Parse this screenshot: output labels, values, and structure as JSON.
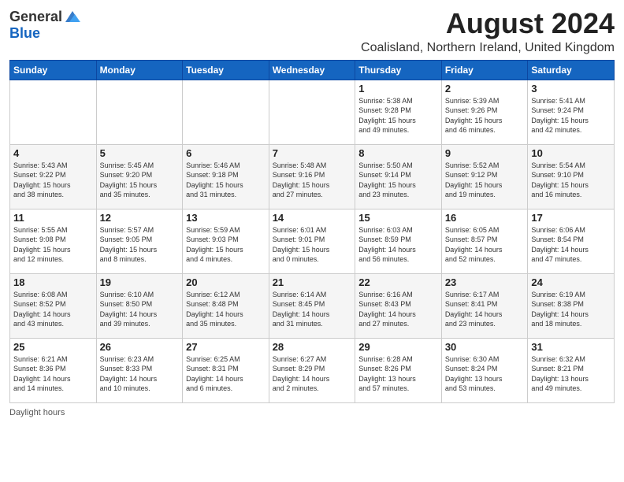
{
  "header": {
    "logo_general": "General",
    "logo_blue": "Blue",
    "month_title": "August 2024",
    "location": "Coalisland, Northern Ireland, United Kingdom"
  },
  "days_of_week": [
    "Sunday",
    "Monday",
    "Tuesday",
    "Wednesday",
    "Thursday",
    "Friday",
    "Saturday"
  ],
  "weeks": [
    [
      {
        "day": "",
        "info": ""
      },
      {
        "day": "",
        "info": ""
      },
      {
        "day": "",
        "info": ""
      },
      {
        "day": "",
        "info": ""
      },
      {
        "day": "1",
        "info": "Sunrise: 5:38 AM\nSunset: 9:28 PM\nDaylight: 15 hours\nand 49 minutes."
      },
      {
        "day": "2",
        "info": "Sunrise: 5:39 AM\nSunset: 9:26 PM\nDaylight: 15 hours\nand 46 minutes."
      },
      {
        "day": "3",
        "info": "Sunrise: 5:41 AM\nSunset: 9:24 PM\nDaylight: 15 hours\nand 42 minutes."
      }
    ],
    [
      {
        "day": "4",
        "info": "Sunrise: 5:43 AM\nSunset: 9:22 PM\nDaylight: 15 hours\nand 38 minutes."
      },
      {
        "day": "5",
        "info": "Sunrise: 5:45 AM\nSunset: 9:20 PM\nDaylight: 15 hours\nand 35 minutes."
      },
      {
        "day": "6",
        "info": "Sunrise: 5:46 AM\nSunset: 9:18 PM\nDaylight: 15 hours\nand 31 minutes."
      },
      {
        "day": "7",
        "info": "Sunrise: 5:48 AM\nSunset: 9:16 PM\nDaylight: 15 hours\nand 27 minutes."
      },
      {
        "day": "8",
        "info": "Sunrise: 5:50 AM\nSunset: 9:14 PM\nDaylight: 15 hours\nand 23 minutes."
      },
      {
        "day": "9",
        "info": "Sunrise: 5:52 AM\nSunset: 9:12 PM\nDaylight: 15 hours\nand 19 minutes."
      },
      {
        "day": "10",
        "info": "Sunrise: 5:54 AM\nSunset: 9:10 PM\nDaylight: 15 hours\nand 16 minutes."
      }
    ],
    [
      {
        "day": "11",
        "info": "Sunrise: 5:55 AM\nSunset: 9:08 PM\nDaylight: 15 hours\nand 12 minutes."
      },
      {
        "day": "12",
        "info": "Sunrise: 5:57 AM\nSunset: 9:05 PM\nDaylight: 15 hours\nand 8 minutes."
      },
      {
        "day": "13",
        "info": "Sunrise: 5:59 AM\nSunset: 9:03 PM\nDaylight: 15 hours\nand 4 minutes."
      },
      {
        "day": "14",
        "info": "Sunrise: 6:01 AM\nSunset: 9:01 PM\nDaylight: 15 hours\nand 0 minutes."
      },
      {
        "day": "15",
        "info": "Sunrise: 6:03 AM\nSunset: 8:59 PM\nDaylight: 14 hours\nand 56 minutes."
      },
      {
        "day": "16",
        "info": "Sunrise: 6:05 AM\nSunset: 8:57 PM\nDaylight: 14 hours\nand 52 minutes."
      },
      {
        "day": "17",
        "info": "Sunrise: 6:06 AM\nSunset: 8:54 PM\nDaylight: 14 hours\nand 47 minutes."
      }
    ],
    [
      {
        "day": "18",
        "info": "Sunrise: 6:08 AM\nSunset: 8:52 PM\nDaylight: 14 hours\nand 43 minutes."
      },
      {
        "day": "19",
        "info": "Sunrise: 6:10 AM\nSunset: 8:50 PM\nDaylight: 14 hours\nand 39 minutes."
      },
      {
        "day": "20",
        "info": "Sunrise: 6:12 AM\nSunset: 8:48 PM\nDaylight: 14 hours\nand 35 minutes."
      },
      {
        "day": "21",
        "info": "Sunrise: 6:14 AM\nSunset: 8:45 PM\nDaylight: 14 hours\nand 31 minutes."
      },
      {
        "day": "22",
        "info": "Sunrise: 6:16 AM\nSunset: 8:43 PM\nDaylight: 14 hours\nand 27 minutes."
      },
      {
        "day": "23",
        "info": "Sunrise: 6:17 AM\nSunset: 8:41 PM\nDaylight: 14 hours\nand 23 minutes."
      },
      {
        "day": "24",
        "info": "Sunrise: 6:19 AM\nSunset: 8:38 PM\nDaylight: 14 hours\nand 18 minutes."
      }
    ],
    [
      {
        "day": "25",
        "info": "Sunrise: 6:21 AM\nSunset: 8:36 PM\nDaylight: 14 hours\nand 14 minutes."
      },
      {
        "day": "26",
        "info": "Sunrise: 6:23 AM\nSunset: 8:33 PM\nDaylight: 14 hours\nand 10 minutes."
      },
      {
        "day": "27",
        "info": "Sunrise: 6:25 AM\nSunset: 8:31 PM\nDaylight: 14 hours\nand 6 minutes."
      },
      {
        "day": "28",
        "info": "Sunrise: 6:27 AM\nSunset: 8:29 PM\nDaylight: 14 hours\nand 2 minutes."
      },
      {
        "day": "29",
        "info": "Sunrise: 6:28 AM\nSunset: 8:26 PM\nDaylight: 13 hours\nand 57 minutes."
      },
      {
        "day": "30",
        "info": "Sunrise: 6:30 AM\nSunset: 8:24 PM\nDaylight: 13 hours\nand 53 minutes."
      },
      {
        "day": "31",
        "info": "Sunrise: 6:32 AM\nSunset: 8:21 PM\nDaylight: 13 hours\nand 49 minutes."
      }
    ]
  ],
  "footer": {
    "daylight_hours": "Daylight hours"
  }
}
